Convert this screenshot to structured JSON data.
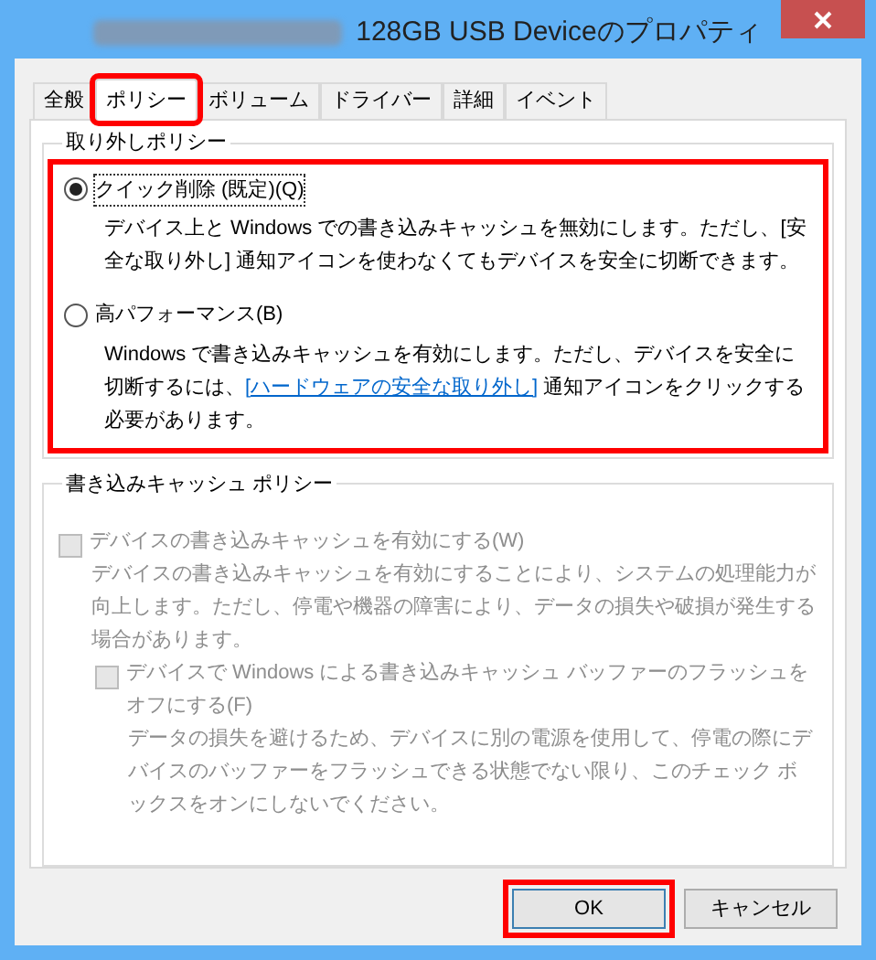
{
  "window": {
    "title": "128GB USB Deviceのプロパティ"
  },
  "tabs": [
    {
      "label": "全般",
      "selected": false,
      "highlighted": false
    },
    {
      "label": "ポリシー",
      "selected": true,
      "highlighted": true
    },
    {
      "label": "ボリューム",
      "selected": false,
      "highlighted": false
    },
    {
      "label": "ドライバー",
      "selected": false,
      "highlighted": false
    },
    {
      "label": "詳細",
      "selected": false,
      "highlighted": false
    },
    {
      "label": "イベント",
      "selected": false,
      "highlighted": false
    }
  ],
  "removal_policy": {
    "title": "取り外しポリシー",
    "highlighted": true,
    "options": [
      {
        "label": "クイック削除 (既定)(Q)",
        "selected": true,
        "description": "デバイス上と Windows での書き込みキャッシュを無効にします。ただし、[安全な取り外し] 通知アイコンを使わなくてもデバイスを安全に切断できます。"
      },
      {
        "label": "高パフォーマンス(B)",
        "selected": false,
        "description_before": "Windows で書き込みキャッシュを有効にします。ただし、デバイスを安全に切断するには、",
        "link": "[ハードウェアの安全な取り外し]",
        "description_after": " 通知アイコンをクリックする必要があります。"
      }
    ]
  },
  "write_cache_policy": {
    "title": "書き込みキャッシュ ポリシー",
    "options": [
      {
        "label": "デバイスの書き込みキャッシュを有効にする(W)",
        "checked": false,
        "disabled": true,
        "description": "デバイスの書き込みキャッシュを有効にすることにより、システムの処理能力が向上します。ただし、停電や機器の障害により、データの損失や破損が発生する場合があります。"
      },
      {
        "label": "デバイスで Windows による書き込みキャッシュ バッファーのフラッシュをオフにする(F)",
        "checked": false,
        "disabled": true,
        "description": "データの損失を避けるため、デバイスに別の電源を使用して、停電の際にデバイスのバッファーをフラッシュできる状態でない限り、このチェック ボックスをオンにしないでください。"
      }
    ]
  },
  "buttons": [
    {
      "label": "OK",
      "highlighted": true
    },
    {
      "label": "キャンセル",
      "highlighted": false
    }
  ]
}
